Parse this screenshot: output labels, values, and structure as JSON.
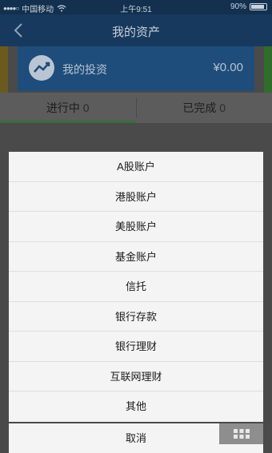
{
  "status_bar": {
    "carrier": "中国移动",
    "time": "上午9:51",
    "battery": "90%"
  },
  "nav": {
    "title": "我的资产"
  },
  "invest_card": {
    "label": "我的投资",
    "amount": "¥0.00"
  },
  "tabs": [
    {
      "label": "进行中",
      "count": "0"
    },
    {
      "label": "已完成",
      "count": "0"
    }
  ],
  "action_sheet": {
    "items": [
      "A股账户",
      "港股账户",
      "美股账户",
      "基金账户",
      "信托",
      "银行存款",
      "银行理财",
      "互联网理财",
      "其他"
    ],
    "cancel": "取消"
  },
  "colors": {
    "nav": "#17395e",
    "sheet": "#f4f4f4"
  }
}
